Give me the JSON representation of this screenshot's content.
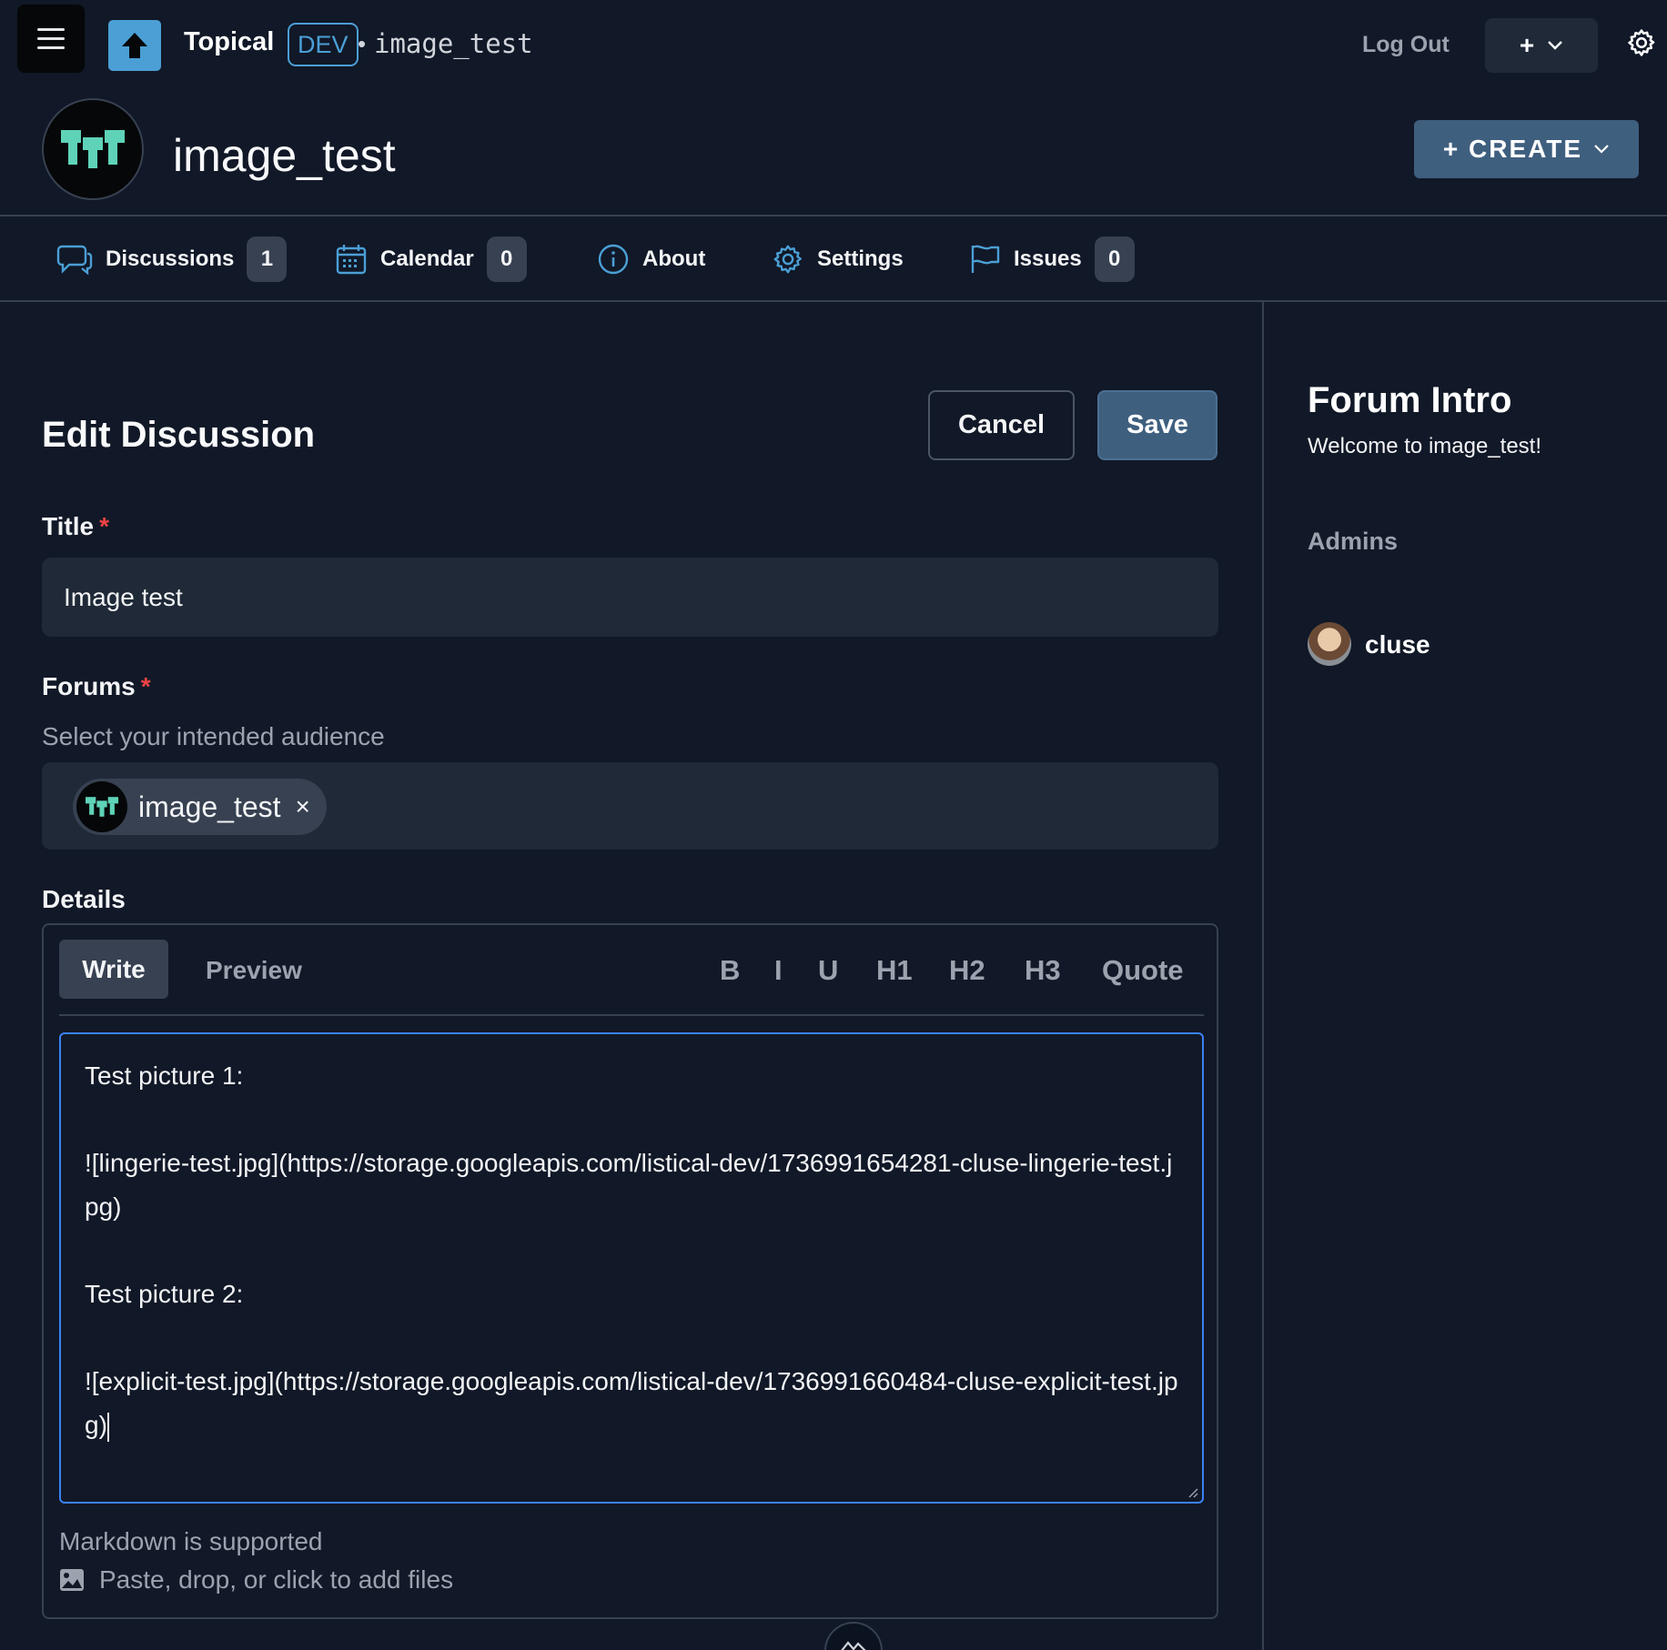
{
  "header": {
    "brand": "Topical",
    "env_badge": "DEV",
    "separator": "•",
    "breadcrumb": "image_test",
    "logout_label": "Log Out",
    "plus_label": "+"
  },
  "forum": {
    "name": "image_test",
    "create_label": "+ CREATE"
  },
  "tabs": [
    {
      "label": "Discussions",
      "count": "1",
      "icon": "chat-icon"
    },
    {
      "label": "Calendar",
      "count": "0",
      "icon": "calendar-icon"
    },
    {
      "label": "About",
      "icon": "info-icon"
    },
    {
      "label": "Settings",
      "icon": "gear-icon"
    },
    {
      "label": "Issues",
      "count": "0",
      "icon": "flag-icon"
    }
  ],
  "form": {
    "heading": "Edit Discussion",
    "cancel_label": "Cancel",
    "save_label": "Save",
    "title_label": "Title",
    "required_mark": "*",
    "title_value": "Image test",
    "forums_label": "Forums",
    "forums_hint": "Select your intended audience",
    "forum_chip": "image_test",
    "chip_remove": "×",
    "details_label": "Details",
    "editor": {
      "write_tab": "Write",
      "preview_tab": "Preview",
      "format_buttons": [
        "B",
        "I",
        "U",
        "H1",
        "H2",
        "H3",
        "Quote"
      ],
      "content": "Test picture 1:\n\n![lingerie-test.jpg](https://storage.googleapis.com/listical-dev/1736991654281-cluse-lingerie-test.jpg)\n\nTest picture 2:\n\n![explicit-test.jpg](https://storage.googleapis.com/listical-dev/1736991660484-cluse-explicit-test.jpg)",
      "markdown_note": "Markdown is supported",
      "attach_note": "Paste, drop, or click to add files"
    }
  },
  "sidebar": {
    "title": "Forum Intro",
    "welcome": "Welcome to image_test!",
    "admins_label": "Admins",
    "admins": [
      {
        "name": "cluse"
      }
    ]
  },
  "colors": {
    "background": "#111827",
    "accent": "#4b9fd5",
    "primary_button": "#3f5f7f",
    "forum_logo": "#5fd3b8",
    "required": "#ef4444"
  }
}
